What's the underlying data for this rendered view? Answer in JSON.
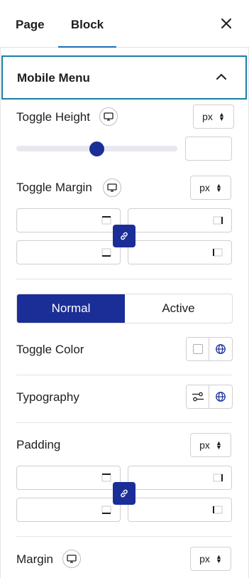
{
  "tabs": {
    "page": "Page",
    "block": "Block"
  },
  "section": {
    "title": "Mobile Menu"
  },
  "toggle_height": {
    "label": "Toggle Height",
    "unit": "px",
    "value": "",
    "slider_level_percent": 45
  },
  "toggle_margin": {
    "label": "Toggle Margin",
    "unit": "px"
  },
  "state_tabs": {
    "normal": "Normal",
    "active": "Active"
  },
  "toggle_color": {
    "label": "Toggle Color"
  },
  "typography": {
    "label": "Typography"
  },
  "padding": {
    "label": "Padding",
    "unit": "px"
  },
  "margin": {
    "label": "Margin",
    "unit": "px"
  },
  "colors": {
    "accent": "#1b2e97",
    "focus_border": "#1b7fa6",
    "tab_underline": "#1d6fb8"
  }
}
